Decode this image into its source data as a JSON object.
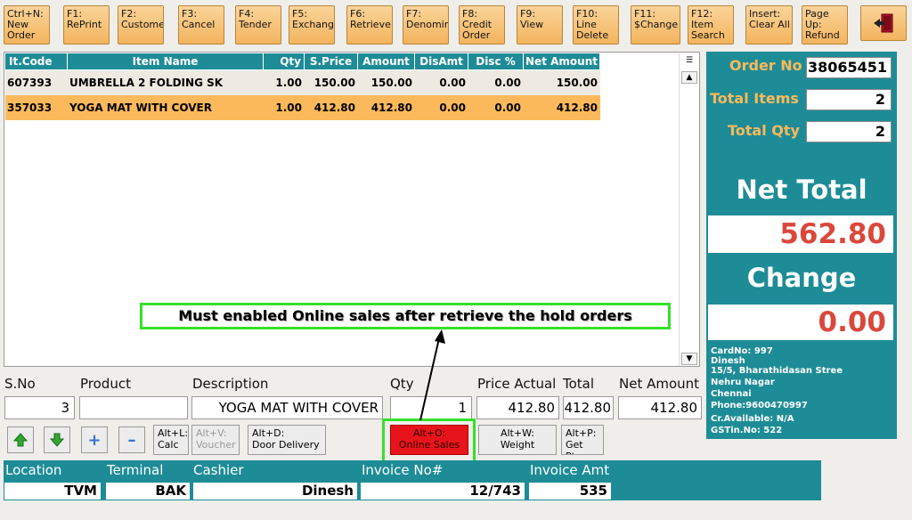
{
  "toolbar": {
    "buttons": [
      {
        "label": "Ctrl+N:\nNew\nOrder"
      },
      {
        "label": "F1:\nRePrint"
      },
      {
        "label": "F2:\nCustome"
      },
      {
        "label": "F3:\nCancel"
      },
      {
        "label": "F4:\nTender"
      },
      {
        "label": "F5:\nExchang"
      },
      {
        "label": "F6:\nRetrieve"
      },
      {
        "label": "F7:\nDenomin"
      },
      {
        "label": "F8:\nCredit\nOrder"
      },
      {
        "label": "F9:\nView"
      },
      {
        "label": "F10:\nLine\nDelete"
      },
      {
        "label": "F11:\n$Change"
      },
      {
        "label": "F12:\nItem\nSearch"
      },
      {
        "label": "Insert:\nClear All"
      },
      {
        "label": "Page\nUp:\nRefund"
      }
    ],
    "exit_icon": "exit-door-icon"
  },
  "grid": {
    "headers": [
      "It.Code",
      "Item Name",
      "Qty",
      "S.Price",
      "Amount",
      "DisAmt",
      "Disc %",
      "Net Amount"
    ],
    "rows": [
      {
        "code": "607393",
        "name": "UMBRELLA 2 FOLDING SK",
        "qty": "1.00",
        "sprice": "150.00",
        "amount": "150.00",
        "disamt": "0.00",
        "disc": "0.00",
        "net": "150.00"
      },
      {
        "code": "357033",
        "name": "YOGA MAT WITH COVER",
        "qty": "1.00",
        "sprice": "412.80",
        "amount": "412.80",
        "disamt": "0.00",
        "disc": "0.00",
        "net": "412.80"
      }
    ],
    "selected_row_color": "#fcb95b"
  },
  "summary": {
    "order_no_label": "Order No",
    "order_no": "38065451",
    "total_items_label": "Total Items",
    "total_items": "2",
    "total_qty_label": "Total Qty",
    "total_qty": "2",
    "net_total_label": "Net Total",
    "net_total": "562.80",
    "change_label": "Change",
    "change": "0.00"
  },
  "customer": {
    "line1": "CardNo: 997",
    "line2": "Dinesh",
    "line3": "15/5, Bharathidasan Stree",
    "line4": "Nehru Nagar",
    "line5": "Chennai",
    "line6": "Phone:9600470997",
    "line7": "Cr.Available: N/A",
    "line8": "GSTin.No: 522"
  },
  "entry": {
    "sno_label": "S.No",
    "product_label": "Product",
    "description_label": "Description",
    "qty_label": "Qty",
    "price_label": "Price Actual",
    "total_label": "Total",
    "net_label": "Net Amount",
    "sno": "3",
    "product": "",
    "description": "YOGA MAT WITH COVER",
    "qty": "1",
    "price": "412.80",
    "total": "412.80",
    "net": "412.80"
  },
  "actions": {
    "calc": "Alt+L:\nCalc",
    "voucher": "Alt+V:\nVoucher",
    "door": "Alt+D:\nDoor Delivery",
    "online": "Alt+O:\nOnline Sales",
    "weight": "Alt+W:\nWeight",
    "points": "Alt+P:\nGet\nPts"
  },
  "footer": {
    "location_label": "Location",
    "terminal_label": "Terminal",
    "cashier_label": "Cashier",
    "invoice_no_label": "Invoice No#",
    "invoice_amt_label": "Invoice Amt",
    "location": "TVM",
    "terminal": "BAK",
    "cashier": "Dinesh",
    "invoice_no": "12/743",
    "invoice_amt": "535"
  },
  "annotation": {
    "text": "Must enabled Online sales after retrieve the hold orders"
  },
  "colors": {
    "teal": "#1e8c96",
    "orange": "#fcb95b",
    "online_red": "#e8141c",
    "highlight_green": "#35e12a"
  }
}
